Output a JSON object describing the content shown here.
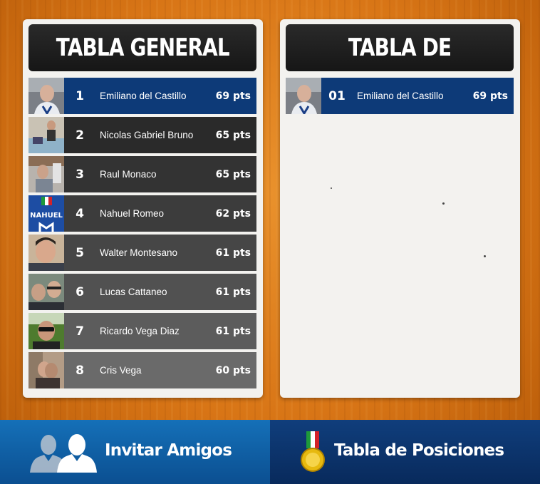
{
  "tabla_general": {
    "title": "TABLA GENERAL",
    "rows": [
      {
        "rank": "1",
        "name": "Emiliano del Castillo",
        "pts": "69 pts",
        "bg": "#0d3a78"
      },
      {
        "rank": "2",
        "name": "Nicolas Gabriel Bruno",
        "pts": "65 pts",
        "bg": "#2a2a2a"
      },
      {
        "rank": "3",
        "name": "Raul Monaco",
        "pts": "65 pts",
        "bg": "#333333"
      },
      {
        "rank": "4",
        "name": "Nahuel Romeo",
        "pts": "62 pts",
        "bg": "#3c3c3c"
      },
      {
        "rank": "5",
        "name": "Walter Montesano",
        "pts": "61 pts",
        "bg": "#464646"
      },
      {
        "rank": "6",
        "name": "Lucas Cattaneo",
        "pts": "61 pts",
        "bg": "#515151"
      },
      {
        "rank": "7",
        "name": "Ricardo Vega Diaz",
        "pts": "61 pts",
        "bg": "#5c5c5c"
      },
      {
        "rank": "8",
        "name": "Cris Vega",
        "pts": "60 pts",
        "bg": "#6a6a6a"
      }
    ]
  },
  "tabla_amigos": {
    "title": "TABLA DE AMIGOS",
    "rows": [
      {
        "rank": "01",
        "name": "Emiliano del Castillo",
        "pts": "69 pts"
      }
    ]
  },
  "bottom_bar": {
    "invitar_label": "Invitar Amigos",
    "tabla_label": "Tabla de Posiciones",
    "invitar_icon": "friends-icon",
    "tabla_icon": "medal-icon"
  },
  "avatar_text": {
    "nahuel": "NAHUEL"
  }
}
